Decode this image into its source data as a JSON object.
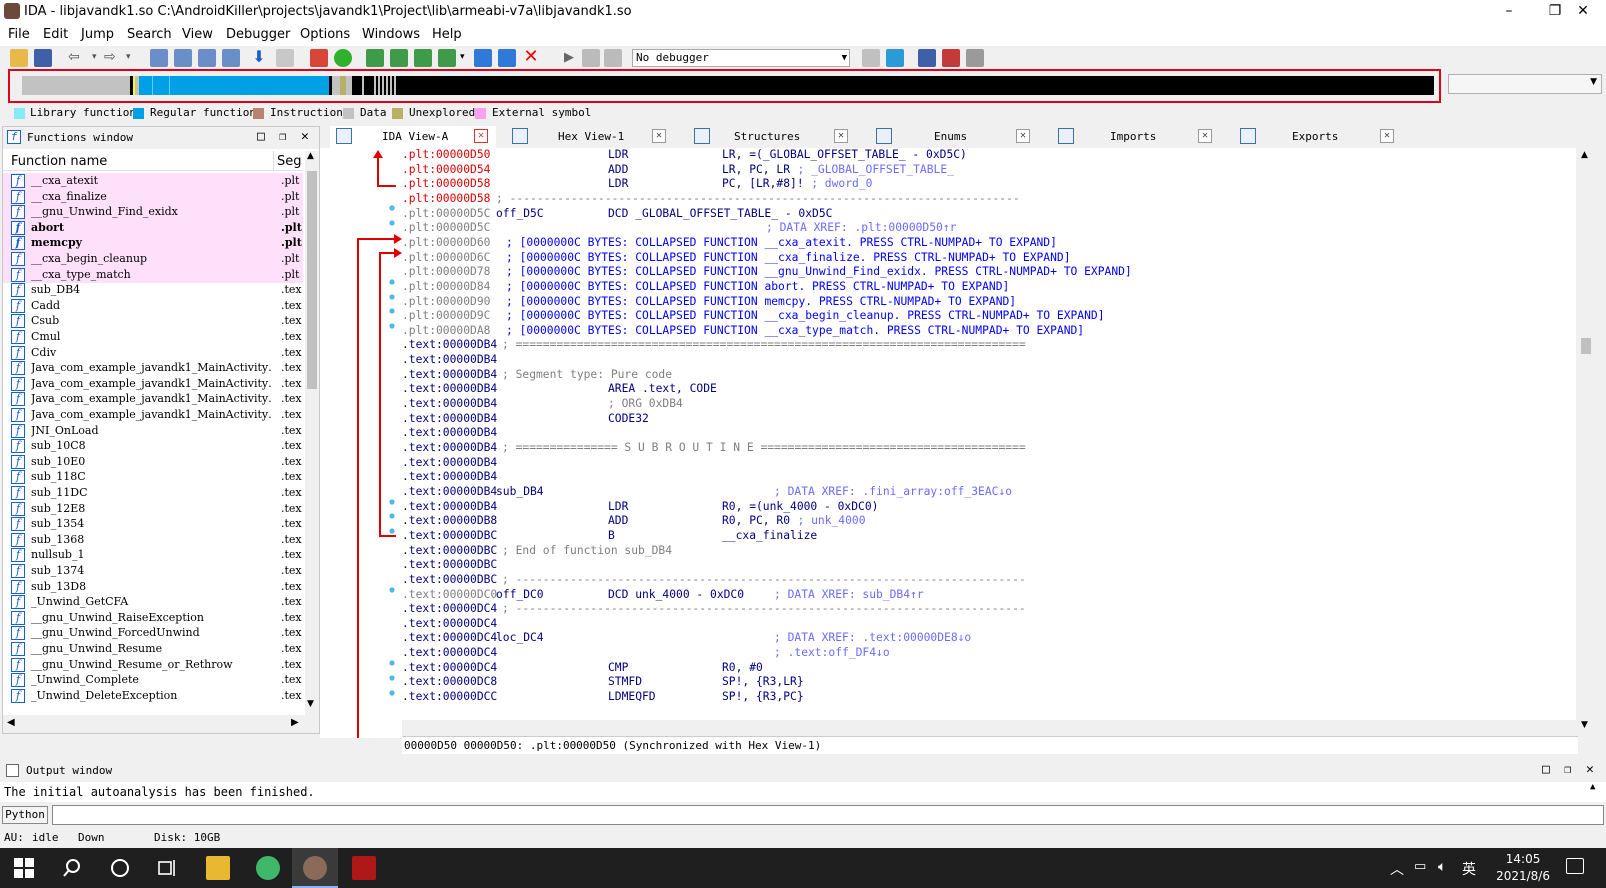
{
  "window": {
    "title": "IDA - libjavandk1.so C:\\AndroidKiller\\projects\\javandk1\\Project\\lib\\armeabi-v7a\\libjavandk1.so",
    "min": "–",
    "max": "❐",
    "close": "✕"
  },
  "menu": [
    "File",
    "Edit",
    "Jump",
    "Search",
    "View",
    "Debugger",
    "Options",
    "Windows",
    "Help"
  ],
  "toolbar": {
    "debugger_select": "No debugger"
  },
  "legend": [
    {
      "label": "Library function",
      "color": "#86ebf6"
    },
    {
      "label": "Regular function",
      "color": "#00a0e6"
    },
    {
      "label": "Instruction",
      "color": "#b9846d"
    },
    {
      "label": "Data",
      "color": "#c2c2c2"
    },
    {
      "label": "Unexplored",
      "color": "#b8b066"
    },
    {
      "label": "External symbol",
      "color": "#ff9ff0"
    }
  ],
  "functions_window": {
    "title": "Functions window",
    "col_name": "Function name",
    "col_seg": "Seg",
    "rows": [
      {
        "name": "__cxa_atexit",
        "seg": ".plt",
        "pink": true,
        "bold": false
      },
      {
        "name": "__cxa_finalize",
        "seg": ".plt",
        "pink": true,
        "bold": false
      },
      {
        "name": "__gnu_Unwind_Find_exidx",
        "seg": ".plt",
        "pink": true,
        "bold": false
      },
      {
        "name": "abort",
        "seg": ".plt",
        "pink": true,
        "bold": true
      },
      {
        "name": "memcpy",
        "seg": ".plt",
        "pink": true,
        "bold": true
      },
      {
        "name": "__cxa_begin_cleanup",
        "seg": ".plt",
        "pink": true,
        "bold": false
      },
      {
        "name": "__cxa_type_match",
        "seg": ".plt",
        "pink": true,
        "bold": false
      },
      {
        "name": "sub_DB4",
        "seg": ".tex",
        "pink": false,
        "bold": false
      },
      {
        "name": "Cadd",
        "seg": ".tex",
        "pink": false,
        "bold": false
      },
      {
        "name": "Csub",
        "seg": ".tex",
        "pink": false,
        "bold": false
      },
      {
        "name": "Cmul",
        "seg": ".tex",
        "pink": false,
        "bold": false
      },
      {
        "name": "Cdiv",
        "seg": ".tex",
        "pink": false,
        "bold": false
      },
      {
        "name": "Java_com_example_javandk1_MainActivity…",
        "seg": ".tex",
        "pink": false,
        "bold": false
      },
      {
        "name": "Java_com_example_javandk1_MainActivity…",
        "seg": ".tex",
        "pink": false,
        "bold": false
      },
      {
        "name": "Java_com_example_javandk1_MainActivity…",
        "seg": ".tex",
        "pink": false,
        "bold": false
      },
      {
        "name": "Java_com_example_javandk1_MainActivity…",
        "seg": ".tex",
        "pink": false,
        "bold": false
      },
      {
        "name": "JNI_OnLoad",
        "seg": ".tex",
        "pink": false,
        "bold": false
      },
      {
        "name": "sub_10C8",
        "seg": ".tex",
        "pink": false,
        "bold": false
      },
      {
        "name": "sub_10E0",
        "seg": ".tex",
        "pink": false,
        "bold": false
      },
      {
        "name": "sub_118C",
        "seg": ".tex",
        "pink": false,
        "bold": false
      },
      {
        "name": "sub_11DC",
        "seg": ".tex",
        "pink": false,
        "bold": false
      },
      {
        "name": "sub_12E8",
        "seg": ".tex",
        "pink": false,
        "bold": false
      },
      {
        "name": "sub_1354",
        "seg": ".tex",
        "pink": false,
        "bold": false
      },
      {
        "name": "sub_1368",
        "seg": ".tex",
        "pink": false,
        "bold": false
      },
      {
        "name": "nullsub_1",
        "seg": ".tex",
        "pink": false,
        "bold": false
      },
      {
        "name": "sub_1374",
        "seg": ".tex",
        "pink": false,
        "bold": false
      },
      {
        "name": "sub_13D8",
        "seg": ".tex",
        "pink": false,
        "bold": false
      },
      {
        "name": "_Unwind_GetCFA",
        "seg": ".tex",
        "pink": false,
        "bold": false
      },
      {
        "name": "__gnu_Unwind_RaiseException",
        "seg": ".tex",
        "pink": false,
        "bold": false
      },
      {
        "name": "__gnu_Unwind_ForcedUnwind",
        "seg": ".tex",
        "pink": false,
        "bold": false
      },
      {
        "name": "__gnu_Unwind_Resume",
        "seg": ".tex",
        "pink": false,
        "bold": false
      },
      {
        "name": "__gnu_Unwind_Resume_or_Rethrow",
        "seg": ".tex",
        "pink": false,
        "bold": false
      },
      {
        "name": "_Unwind_Complete",
        "seg": ".tex",
        "pink": false,
        "bold": false
      },
      {
        "name": "_Unwind_DeleteException",
        "seg": ".tex",
        "pink": false,
        "bold": false
      }
    ]
  },
  "tabs": [
    {
      "label": "IDA View-A",
      "active": true
    },
    {
      "label": "Hex View-1",
      "active": false
    },
    {
      "label": "Structures",
      "active": false
    },
    {
      "label": "Enums",
      "active": false
    },
    {
      "label": "Imports",
      "active": false
    },
    {
      "label": "Exports",
      "active": false
    }
  ],
  "disasm": [
    {
      "addr": ".plt:00000D50",
      "label": "",
      "mn": "LDR",
      "op": "LR, =(_GLOBAL_OFFSET_TABLE_ - 0xD5C)",
      "cm": "",
      "type": "ins"
    },
    {
      "addr": ".plt:00000D54",
      "label": "",
      "mn": "ADD",
      "op": "LR, PC, LR",
      "cm": "; _GLOBAL_OFFSET_TABLE_",
      "type": "ins"
    },
    {
      "addr": ".plt:00000D58",
      "label": "",
      "mn": "LDR",
      "op": "PC, [LR,#8]!",
      "cm": "; dword_0",
      "type": "ins"
    },
    {
      "addr": ".plt:00000D58",
      "text": "; ---------------------------------------------------------------------------",
      "type": "sep"
    },
    {
      "addr": ".plt:00000D5C",
      "label": "off_D5C",
      "mn": "DCD _GLOBAL_OFFSET_TABLE_ - 0xD5C",
      "op": "",
      "cm": "",
      "type": "data"
    },
    {
      "addr": ".plt:00000D5C",
      "text": "; DATA XREF: .plt:00000D50↑r",
      "type": "xref"
    },
    {
      "addr": ".plt:00000D60",
      "text": "; [0000000C BYTES: COLLAPSED FUNCTION __cxa_atexit. PRESS CTRL-NUMPAD+ TO EXPAND]",
      "type": "coll"
    },
    {
      "addr": ".plt:00000D6C",
      "text": "; [0000000C BYTES: COLLAPSED FUNCTION __cxa_finalize. PRESS CTRL-NUMPAD+ TO EXPAND]",
      "type": "coll"
    },
    {
      "addr": ".plt:00000D78",
      "text": "; [0000000C BYTES: COLLAPSED FUNCTION __gnu_Unwind_Find_exidx. PRESS CTRL-NUMPAD+ TO EXPAND]",
      "type": "coll"
    },
    {
      "addr": ".plt:00000D84",
      "text": "; [0000000C BYTES: COLLAPSED FUNCTION abort. PRESS CTRL-NUMPAD+ TO EXPAND]",
      "type": "coll"
    },
    {
      "addr": ".plt:00000D90",
      "text": "; [0000000C BYTES: COLLAPSED FUNCTION memcpy. PRESS CTRL-NUMPAD+ TO EXPAND]",
      "type": "coll"
    },
    {
      "addr": ".plt:00000D9C",
      "text": "; [0000000C BYTES: COLLAPSED FUNCTION __cxa_begin_cleanup. PRESS CTRL-NUMPAD+ TO EXPAND]",
      "type": "coll"
    },
    {
      "addr": ".plt:00000DA8",
      "text": "; [0000000C BYTES: COLLAPSED FUNCTION __cxa_type_match. PRESS CTRL-NUMPAD+ TO EXPAND]",
      "type": "coll"
    },
    {
      "addr": ".text:00000DB4",
      "text": "; ===========================================================================",
      "type": "sep"
    },
    {
      "addr": ".text:00000DB4",
      "text": "",
      "type": "blank"
    },
    {
      "addr": ".text:00000DB4",
      "text": "; Segment type: Pure code",
      "type": "segc"
    },
    {
      "addr": ".text:00000DB4",
      "label": "",
      "mn": "AREA .text, CODE",
      "op": "",
      "cm": "",
      "type": "dir"
    },
    {
      "addr": ".text:00000DB4",
      "label": "",
      "mn": "; ORG 0xDB4",
      "op": "",
      "cm": "",
      "type": "dirc"
    },
    {
      "addr": ".text:00000DB4",
      "label": "",
      "mn": "CODE32",
      "op": "",
      "cm": "",
      "type": "dir"
    },
    {
      "addr": ".text:00000DB4",
      "text": "",
      "type": "blank"
    },
    {
      "addr": ".text:00000DB4",
      "text": "; =============== S U B R O U T I N E =======================================",
      "type": "sep"
    },
    {
      "addr": ".text:00000DB4",
      "text": "",
      "type": "blank"
    },
    {
      "addr": ".text:00000DB4",
      "text": "",
      "type": "blank"
    },
    {
      "addr": ".text:00000DB4",
      "label": "sub_DB4",
      "mn": "",
      "op": "",
      "cm": "; DATA XREF: .fini_array:off_3EAC↓o",
      "type": "lblx"
    },
    {
      "addr": ".text:00000DB4",
      "label": "",
      "mn": "LDR",
      "op": "R0, =(unk_4000 - 0xDC0)",
      "cm": "",
      "type": "ins"
    },
    {
      "addr": ".text:00000DB8",
      "label": "",
      "mn": "ADD",
      "op": "R0, PC, R0",
      "cm": "; unk_4000",
      "type": "ins"
    },
    {
      "addr": ".text:00000DBC",
      "label": "",
      "mn": "B",
      "op": "__cxa_finalize",
      "cm": "",
      "type": "ins"
    },
    {
      "addr": ".text:00000DBC",
      "text": "; End of function sub_DB4",
      "type": "segc"
    },
    {
      "addr": ".text:00000DBC",
      "text": "",
      "type": "blank"
    },
    {
      "addr": ".text:00000DBC",
      "text": "; ---------------------------------------------------------------------------",
      "type": "sep"
    },
    {
      "addr": ".text:00000DC0",
      "label": "off_DC0",
      "mn": "DCD unk_4000 - 0xDC0",
      "op": "",
      "cm": "; DATA XREF: sub_DB4↑r",
      "type": "data2"
    },
    {
      "addr": ".text:00000DC4",
      "text": "; ---------------------------------------------------------------------------",
      "type": "sep"
    },
    {
      "addr": ".text:00000DC4",
      "text": "",
      "type": "blank"
    },
    {
      "addr": ".text:00000DC4",
      "label": "loc_DC4",
      "mn": "",
      "op": "",
      "cm": "; DATA XREF: .text:00000DE8↓o",
      "type": "lblx"
    },
    {
      "addr": ".text:00000DC4",
      "label": "",
      "mn": "",
      "op": "",
      "cm": "; .text:off_DF4↓o",
      "type": "lblx"
    },
    {
      "addr": ".text:00000DC4",
      "label": "",
      "mn": "CMP",
      "op": "R0, #0",
      "cm": "",
      "type": "ins"
    },
    {
      "addr": ".text:00000DC8",
      "label": "",
      "mn": "STMFD",
      "op": "SP!, {R3,LR}",
      "cm": "",
      "type": "ins"
    },
    {
      "addr": ".text:00000DCC",
      "label": "",
      "mn": "LDMEQFD",
      "op": "SP!, {R3,PC}",
      "cm": "",
      "type": "ins"
    }
  ],
  "status_line": "00000D50 00000D50: .plt:00000D50 (Synchronized with Hex View-1)",
  "output_window": {
    "title": "Output window",
    "text": "The initial autoanalysis has been finished."
  },
  "python_button": "Python",
  "statusbar": {
    "au": "AU:",
    "au_state": "idle",
    "dir": "Down",
    "disk": "Disk: 10GB"
  },
  "taskbar": {
    "time": "14:05",
    "date": "2021/8/6",
    "ime": "英"
  }
}
